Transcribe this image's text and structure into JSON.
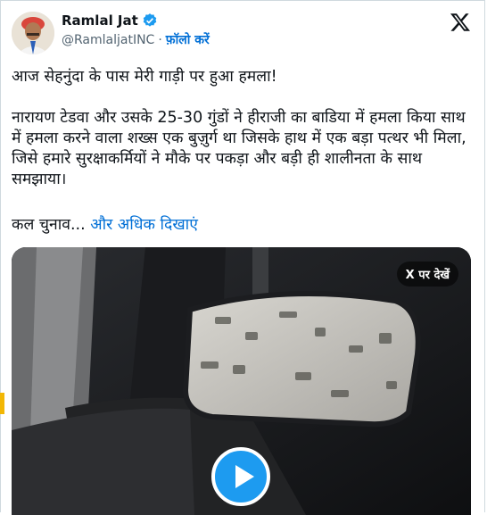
{
  "tweet": {
    "author_name": "Ramlal Jat",
    "author_handle": "@RamlaljatINC",
    "separator": "·",
    "follow_label": "फ़ॉलो करें",
    "line1": "आज सेहनुंदा के पास मेरी गाड़ी पर हुआ हमला!",
    "paragraph": "नारायण टेडवा और उसके 25-30 गुंडों ने हीराजी का बाडिया में हमला किया साथ में हमला करने वाला शख्स एक बुज़ुर्ग था जिसके हाथ में एक बड़ा पत्थर भी मिला, जिसे हमारे सुरक्षाकर्मियों ने मौके पर पकड़ा और बड़ी ही शालीनता के साथ समझाया।",
    "truncated_text": "कल चुनाव...",
    "show_more_label": "और अधिक दिखाएं"
  },
  "media": {
    "watch_on_x_label": "X पर देखें"
  },
  "icons": {
    "verified": "verified-badge-icon",
    "x_logo": "x-logo-icon",
    "play": "play-icon"
  },
  "colors": {
    "link": "#006fd6",
    "verified": "#1d9bf0",
    "play_button": "#1d9bf0"
  }
}
